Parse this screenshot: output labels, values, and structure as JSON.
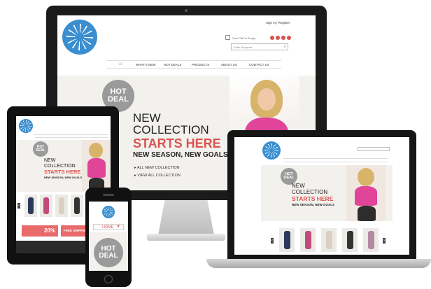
{
  "colors": {
    "brand_blue": "#3a8fd0",
    "accent_red": "#d9534f",
    "pink": "#e0459a",
    "badge_gray": "#9a9a9a"
  },
  "icons": [
    "logo-icon",
    "home-icon",
    "cart-icon",
    "search-icon",
    "social-icon",
    "arrow-left-icon",
    "arrow-right-icon",
    "chevron-down-icon"
  ],
  "desktop": {
    "signin": "Sign In  |  Register",
    "cart": "Your Cart is Empty",
    "search_placeholder": "Enter Keyword",
    "nav": [
      "WHAT'S NEW",
      "HOT DEALS",
      "PRODUCTS",
      "ABOUT US",
      "CONTACT US"
    ],
    "badge_line1": "HOT",
    "badge_line2": "DEAL",
    "headline1": "NEW",
    "headline2": "COLLECTION",
    "headline3": "STARTS HERE",
    "tagline": "NEW SEASON, NEW GOALS",
    "link1": "ALL NEW COLLECTION",
    "link2": "VIEW ALL COLLECTION"
  },
  "tablet": {
    "badge_line1": "HOT",
    "badge_line2": "DEAL",
    "headline1": "NEW",
    "headline2": "COLLECTION",
    "headline3": "STARTS HERE",
    "tagline": "NEW SEASON, NEW GOALS",
    "promo_pct": "20%",
    "promo_shipping": "FREE SHIPPING"
  },
  "laptop": {
    "badge_line1": "HOT",
    "badge_line2": "DEAL",
    "headline1": "NEW",
    "headline2": "COLLECTION",
    "headline3": "STARTS HERE",
    "tagline": "NEW SEASON, NEW GOALS"
  },
  "phone": {
    "menu_label": "HOME",
    "badge_line1": "HOT",
    "badge_line2": "DEAL"
  }
}
